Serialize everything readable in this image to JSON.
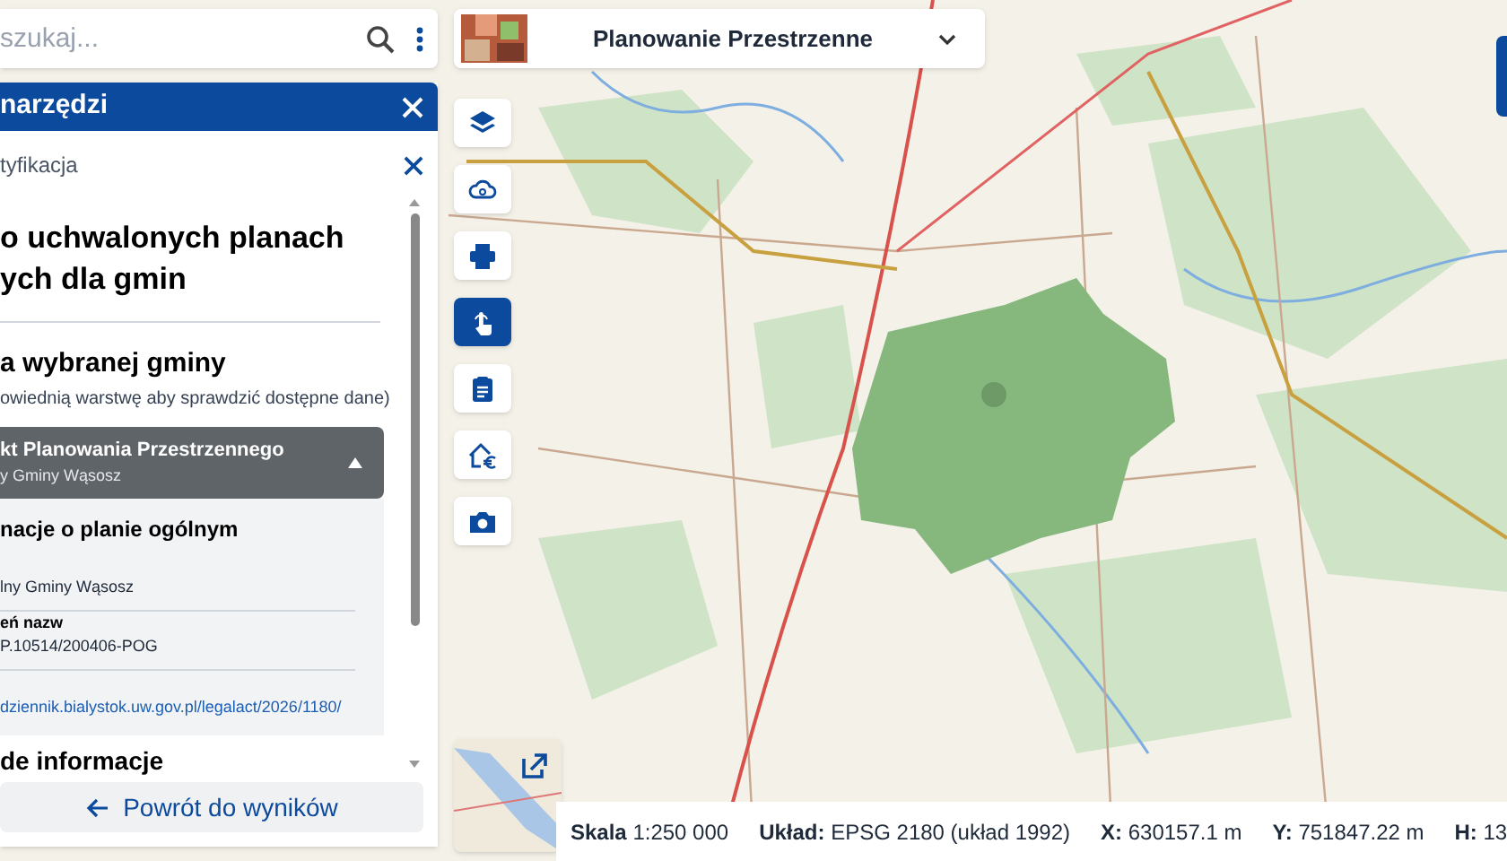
{
  "search": {
    "placeholder": "szukaj..."
  },
  "panel": {
    "title": "narzędzi",
    "subheader": "tyfikacja",
    "heading": [
      "o uchwalonych planach",
      "ych dla gmin"
    ],
    "section_title": "a wybranej gminy",
    "section_hint": "owiednią warstwę aby sprawdzić dostępne dane)",
    "accordion": {
      "title": "kt Planowania Przestrzennego",
      "subtitle": "y Gminy Wąsosz",
      "expanded": true,
      "content_title": "nacje o planie ogólnym",
      "fields": [
        {
          "kind": "text",
          "value": "lny Gminy Wąsosz"
        },
        {
          "kind": "text",
          "label": "eń nazw",
          "value": "P.10514/200406-POG"
        },
        {
          "kind": "link",
          "value": "dziennik.bialystok.uw.gov.pl/legalact/2026/1180/"
        }
      ]
    },
    "next_section": "de informacje",
    "back_button": "Powrót do wyników"
  },
  "layer_selector": {
    "label": "Planowanie Przestrzenne"
  },
  "tools": [
    {
      "selected": false
    },
    {
      "selected": false
    },
    {
      "selected": false
    },
    {
      "selected": true
    },
    {
      "selected": false
    },
    {
      "selected": false
    },
    {
      "selected": false
    }
  ],
  "status_bar": [
    {
      "label": "Skala",
      "value": "1:250 000"
    },
    {
      "label": "Układ:",
      "value": "EPSG 2180 (układ 1992)"
    },
    {
      "label": "X:",
      "value": "630157.1 m"
    },
    {
      "label": "Y:",
      "value": "751847.22 m"
    },
    {
      "label": "H:",
      "value": "13"
    }
  ]
}
